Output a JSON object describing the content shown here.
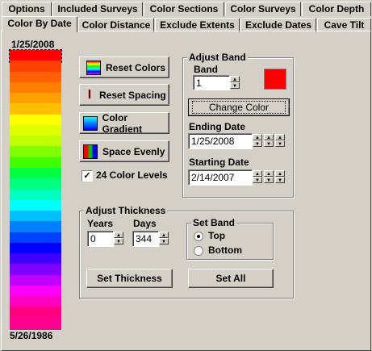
{
  "tabs_row1": [
    "Options",
    "Included Surveys",
    "Color Sections",
    "Color Surveys",
    "Color Depth"
  ],
  "tabs_row2": [
    "Color By Date",
    "Color Distance",
    "Exclude Extents",
    "Exclude Dates",
    "Cave Tilt"
  ],
  "colorbar": {
    "top_date": "1/25/2008",
    "bottom_date": "5/26/1986",
    "bands": [
      "#ff0000",
      "#ff4000",
      "#ff6000",
      "#ff8000",
      "#ffa000",
      "#ffc000",
      "#ffff00",
      "#e0ff00",
      "#c0ff00",
      "#80ff00",
      "#40ff00",
      "#00ff40",
      "#00ff80",
      "#00ffc0",
      "#00ffff",
      "#00c0ff",
      "#0080ff",
      "#0040ff",
      "#0000ff",
      "#4000ff",
      "#8000ff",
      "#c000ff",
      "#ff00ff",
      "#ff00c0",
      "#ff0080",
      "#ff0090"
    ]
  },
  "buttons": {
    "reset_colors": "Reset Colors",
    "reset_spacing": "Reset Spacing",
    "color_gradient": "Color Gradient",
    "space_evenly": "Space Evenly",
    "change_color": "Change Color",
    "set_thickness": "Set Thickness",
    "set_all": "Set All"
  },
  "checkbox_24": {
    "label": "24 Color Levels",
    "checked": true
  },
  "adjust_band": {
    "title": "Adjust Band",
    "band_label": "Band",
    "band_value": "1",
    "band_color": "#ff0000",
    "ending_label": "Ending Date",
    "ending_value": "1/25/2008",
    "starting_label": "Starting Date",
    "starting_value": "2/14/2007"
  },
  "adjust_thickness": {
    "title": "Adjust Thickness",
    "years_label": "Years",
    "years_value": "0",
    "days_label": "Days",
    "days_value": "344",
    "set_band_title": "Set Band",
    "top_label": "Top",
    "bottom_label": "Bottom",
    "selected": "Top"
  }
}
